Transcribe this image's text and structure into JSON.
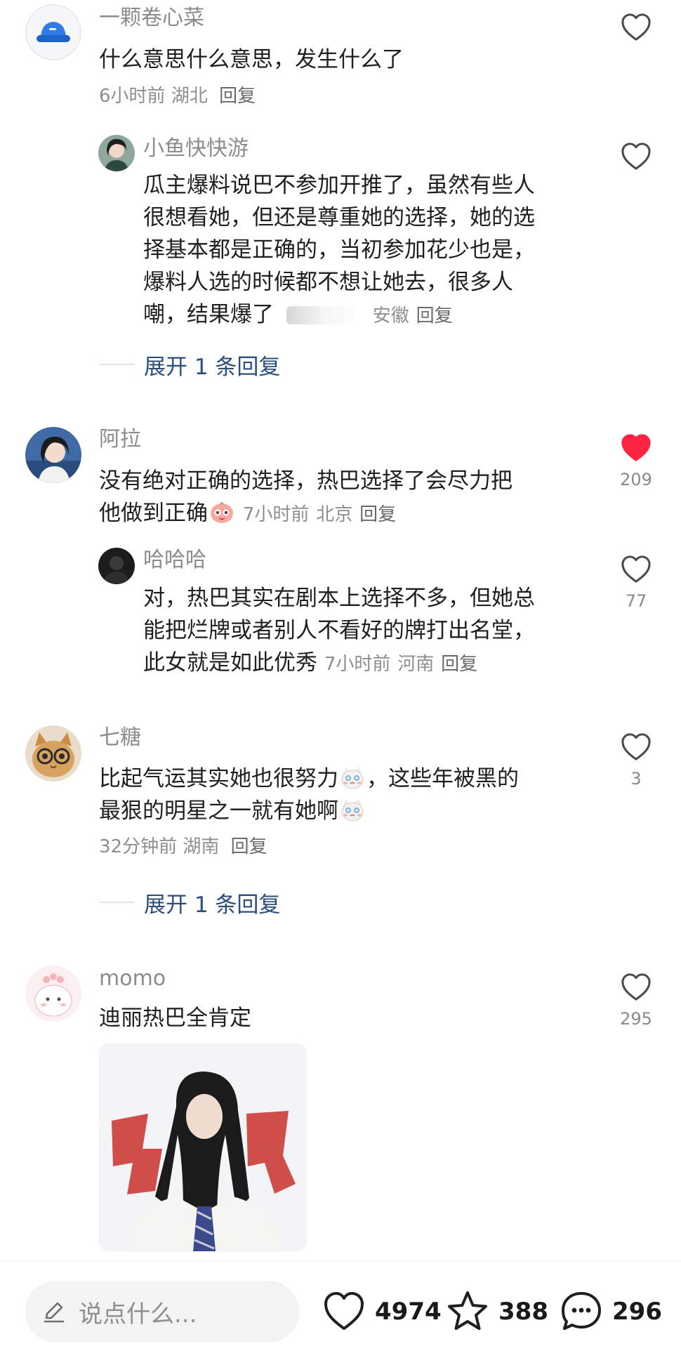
{
  "comments": [
    {
      "username": "一颗卷心菜",
      "lines": [
        "什么意思什么意思，发生什么了"
      ],
      "time": "6小时前",
      "location": "湖北",
      "reply": "回复",
      "replies": [
        {
          "username": "小鱼快快游",
          "lines": [
            "瓜主爆料说巴不参加开推了，虽然有些人",
            "很想看她，但还是尊重她的选择，她的选",
            "择基本都是正确的，当初参加花少也是，",
            "爆料人选的时候都不想让她去，很多人",
            "嘲，结果爆了"
          ],
          "location": "安徽",
          "reply": "回复"
        }
      ],
      "expand": "展开 1 条回复"
    },
    {
      "username": "阿拉",
      "lines": [
        "没有绝对正确的选择，热巴选择了会尽力把",
        "他做到正确"
      ],
      "time": "7小时前",
      "location": "北京",
      "reply": "回复",
      "likes": "209",
      "liked": true,
      "replies": [
        {
          "username": "哈哈哈",
          "lines": [
            "对，热巴其实在剧本上选择不多，但她总",
            "能把烂牌或者别人不看好的牌打出名堂，",
            "此女就是如此优秀"
          ],
          "time": "7小时前",
          "location": "河南",
          "reply": "回复",
          "likes": "77"
        }
      ]
    },
    {
      "username": "七糖",
      "lines": [
        "比起气运其实她也很努力",
        "，这些年被黑的",
        "最狠的明星之一就有她啊"
      ],
      "time": "32分钟前",
      "location": "湖南",
      "reply": "回复",
      "likes": "3",
      "expand": "展开 1 条回复"
    },
    {
      "username": "momo",
      "lines": [
        "迪丽热巴全肯定"
      ],
      "likes": "295"
    }
  ],
  "bottom_bar": {
    "placeholder": "说点什么...",
    "likes": "4974",
    "favorites": "388",
    "comments": "296"
  },
  "colors": {
    "liked_heart": "#ff2442",
    "expand_text": "#2b4e7b",
    "meta_text": "#8e8e8e"
  }
}
